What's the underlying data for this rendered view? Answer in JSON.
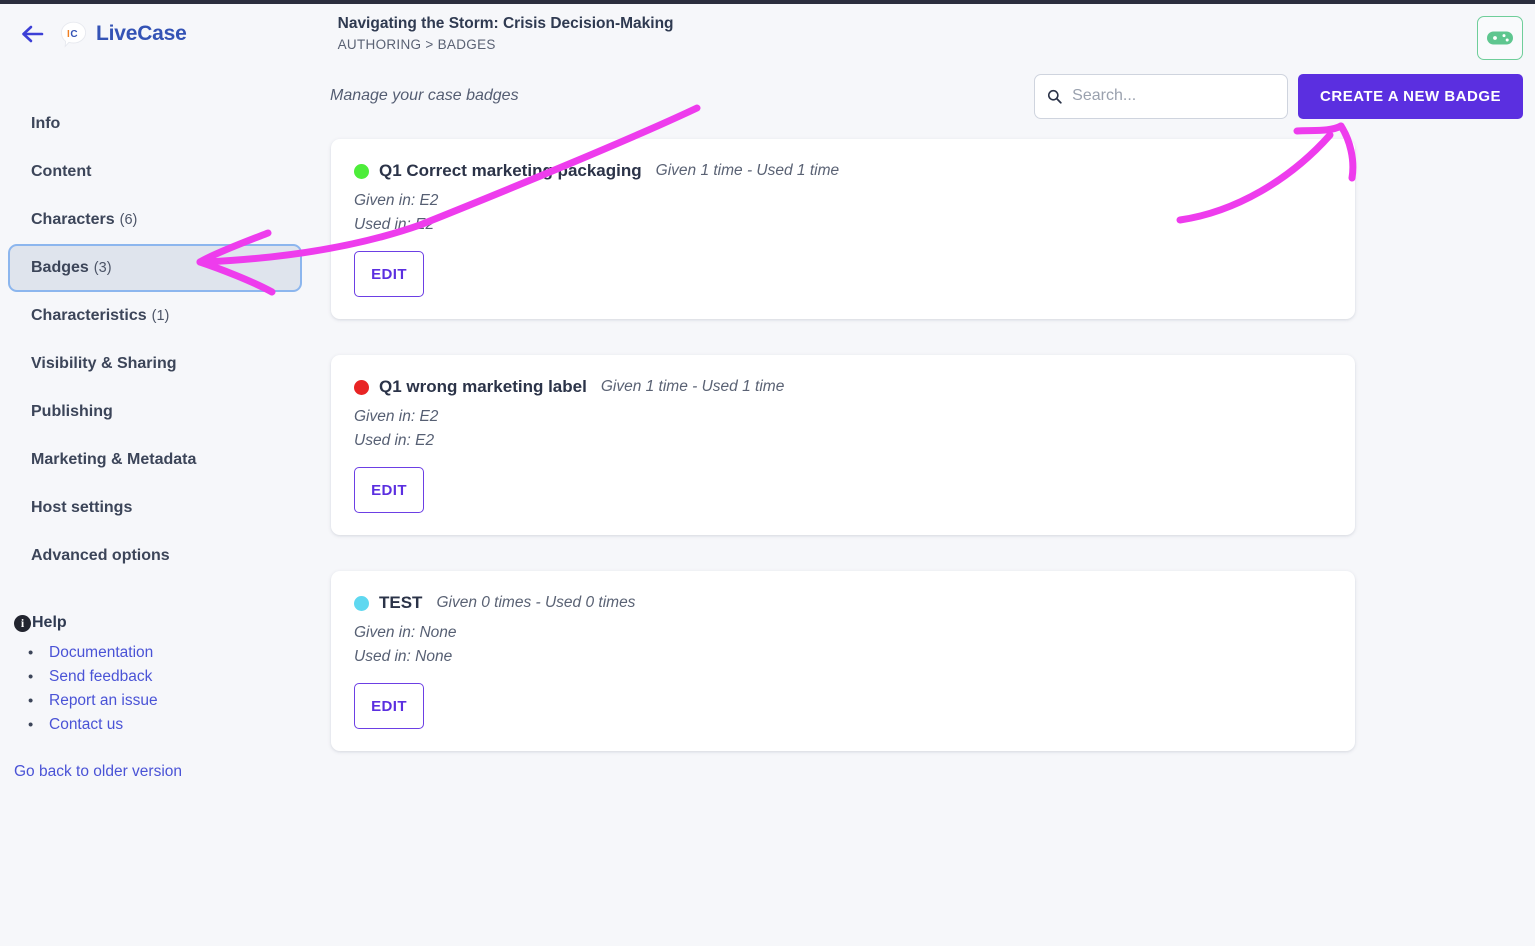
{
  "header": {
    "back_icon": "arrow-left-icon",
    "brand_name": "LiveCase",
    "brand_logo_icon": "livecase-speech-bubble-logo",
    "case_title": "Navigating the Storm: Crisis Decision-Making",
    "breadcrumb": "AUTHORING > BADGES",
    "gamepad_icon": "gamepad-icon"
  },
  "sidebar": {
    "items": [
      {
        "label": "Info",
        "count": "",
        "selected": false
      },
      {
        "label": "Content",
        "count": "",
        "selected": false
      },
      {
        "label": "Characters",
        "count": "(6)",
        "selected": false
      },
      {
        "label": "Badges",
        "count": "(3)",
        "selected": true
      },
      {
        "label": "Characteristics",
        "count": "(1)",
        "selected": false
      },
      {
        "label": "Visibility & Sharing",
        "count": "",
        "selected": false
      },
      {
        "label": "Publishing",
        "count": "",
        "selected": false
      },
      {
        "label": "Marketing & Metadata",
        "count": "",
        "selected": false
      },
      {
        "label": "Host settings",
        "count": "",
        "selected": false
      },
      {
        "label": "Advanced options",
        "count": "",
        "selected": false
      }
    ],
    "help": {
      "title": "Help",
      "info_icon": "info-icon",
      "links": [
        "Documentation",
        "Send feedback",
        "Report an issue",
        "Contact us"
      ]
    },
    "older_version_link": "Go back to older version"
  },
  "main": {
    "subtitle": "Manage your case badges",
    "search": {
      "placeholder": "Search...",
      "value": "",
      "icon": "search-icon"
    },
    "create_button": "CREATE A NEW BADGE",
    "badges": [
      {
        "name": "Q1 Correct marketing packaging",
        "color": "#4ded3a",
        "stats": "Given 1 time  -  Used 1 time",
        "given_in": "Given in: E2",
        "used_in": "Used in: E2",
        "edit_label": "EDIT"
      },
      {
        "name": "Q1 wrong marketing label",
        "color": "#e82424",
        "stats": "Given 1 time  -  Used 1 time",
        "given_in": "Given in: E2",
        "used_in": "Used in: E2",
        "edit_label": "EDIT"
      },
      {
        "name": "TEST",
        "color": "#5fd8f0",
        "stats": "Given 0 times  -  Used 0 times",
        "given_in": "Given in: None",
        "used_in": "Used in: None",
        "edit_label": "EDIT"
      }
    ]
  },
  "colors": {
    "accent_purple": "#5b2fe0",
    "brand_blue": "#3453b5",
    "link_blue": "#4a53d6",
    "annotation_magenta": "#ee3ced",
    "page_background": "#f6f7fa",
    "selected_nav_background": "#dfe4ed",
    "selected_nav_border": "#8cb6ee",
    "gamepad_green": "#6fce9a"
  },
  "annotations": {
    "arrow_to_sidebar": "magenta-arrow-pointing-to-badges-nav",
    "arrow_to_create": "magenta-arrow-pointing-to-create-badge-button"
  }
}
